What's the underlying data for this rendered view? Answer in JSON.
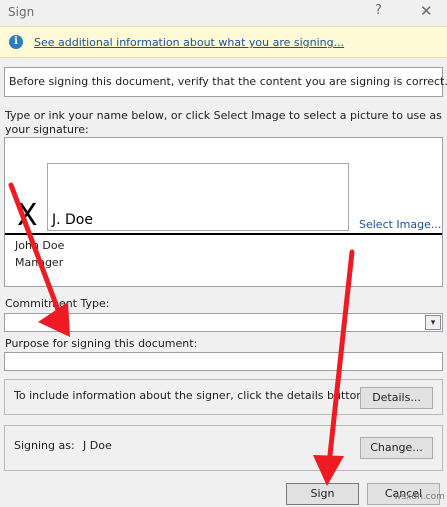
{
  "window": {
    "title": "Sign",
    "help_glyph": "?",
    "close_glyph": "✕"
  },
  "infobar": {
    "icon_glyph": "i",
    "link_text": "See additional information about what you are signing..."
  },
  "verify_text": "Before signing this document, verify that the content you are signing is correct.",
  "type_label": "Type or ink your name below, or click Select Image to select a picture to use as your signature:",
  "signature": {
    "x_mark": "X",
    "typed_name": "J. Doe",
    "select_image_link": "Select Image...",
    "signer_name": "John Doe",
    "signer_title": "Manager"
  },
  "commitment": {
    "label": "Commitment Type:",
    "value": "",
    "arrow_glyph": "▾"
  },
  "purpose": {
    "label": "Purpose for signing this document:",
    "value": ""
  },
  "details": {
    "text": "To include information about the signer, click the details button.",
    "button_label": "Details..."
  },
  "signing_as": {
    "label": "Signing as:",
    "value": "J Doe",
    "button_label": "Change..."
  },
  "footer": {
    "sign_label": "Sign",
    "cancel_label": "Cancel"
  },
  "watermark": "wsxdn.com",
  "colors": {
    "link": "#1e4f9c",
    "info_bar": "#fff9d6",
    "info_icon": "#2a7cc7",
    "annotation_arrow": "#ee1b24"
  }
}
